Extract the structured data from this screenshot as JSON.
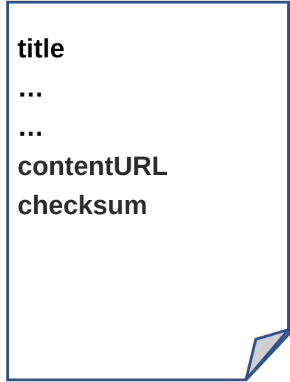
{
  "document": {
    "fields": [
      {
        "text": "title"
      },
      {
        "text": "…"
      },
      {
        "text": "…"
      },
      {
        "text": "contentURL"
      },
      {
        "text": "checksum"
      }
    ]
  },
  "colors": {
    "border": "#2f528f",
    "fold_fill": "#d0d0d0",
    "page_fill": "#ffffff",
    "title_text": "#000000",
    "body_text": "#2b2b2b"
  }
}
